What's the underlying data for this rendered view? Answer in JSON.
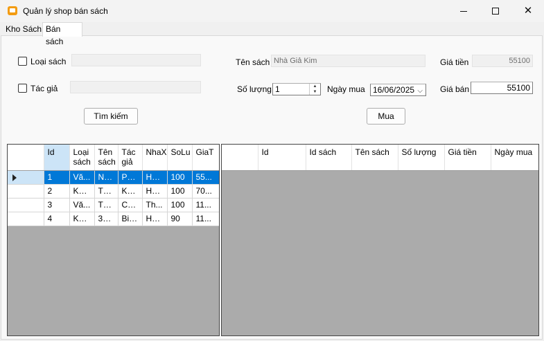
{
  "window": {
    "title": "Quản lý shop bán sách"
  },
  "tabs": [
    {
      "label": "Kho Sách"
    },
    {
      "label": "Bán sách"
    }
  ],
  "search": {
    "category_label": "Loại sách",
    "category_value": "",
    "author_label": "Tác giả",
    "author_value": "",
    "button": "Tìm kiếm"
  },
  "purchase": {
    "book_name_label": "Tên sách",
    "book_name_value": "Nhà Giả Kim",
    "quantity_label": "Số lượng",
    "quantity_value": "1",
    "date_label": "Ngày mua",
    "date_value": "16/06/2025",
    "price_label": "Giá tiền",
    "price_value": "55100",
    "sell_price_label": "Giá bán",
    "sell_price_value": "55100",
    "buy_button": "Mua"
  },
  "books_grid": {
    "columns": [
      "Id",
      "Loại sách",
      "Tên sách",
      "Tác giả",
      "NhaX",
      "SoLu",
      "GiaT"
    ],
    "rows": [
      [
        "1",
        "Vă...",
        "Nh...",
        "Pa...",
        "Hà ...",
        "100",
        "55..."
      ],
      [
        "2",
        "Kỹ ...",
        "Tâ...",
        "Kh...",
        "Hà ...",
        "100",
        "70..."
      ],
      [
        "3",
        "Vă...",
        "Thi...",
        "Ca...",
        "Th...",
        "100",
        "11..."
      ],
      [
        "4",
        "Kỹ ...",
        "38 ...",
        "Biz...",
        "Hồ...",
        "90",
        "11..."
      ]
    ],
    "selected_row": 0
  },
  "sales_grid": {
    "columns": [
      "Id",
      "Id sách",
      "Tên sách",
      "Số lượng",
      "Giá tiền",
      "Ngày mua"
    ],
    "rows": []
  },
  "colors": {
    "selection": "#0078d7",
    "grid_background": "#ababab",
    "app_icon": "#f39c12"
  }
}
